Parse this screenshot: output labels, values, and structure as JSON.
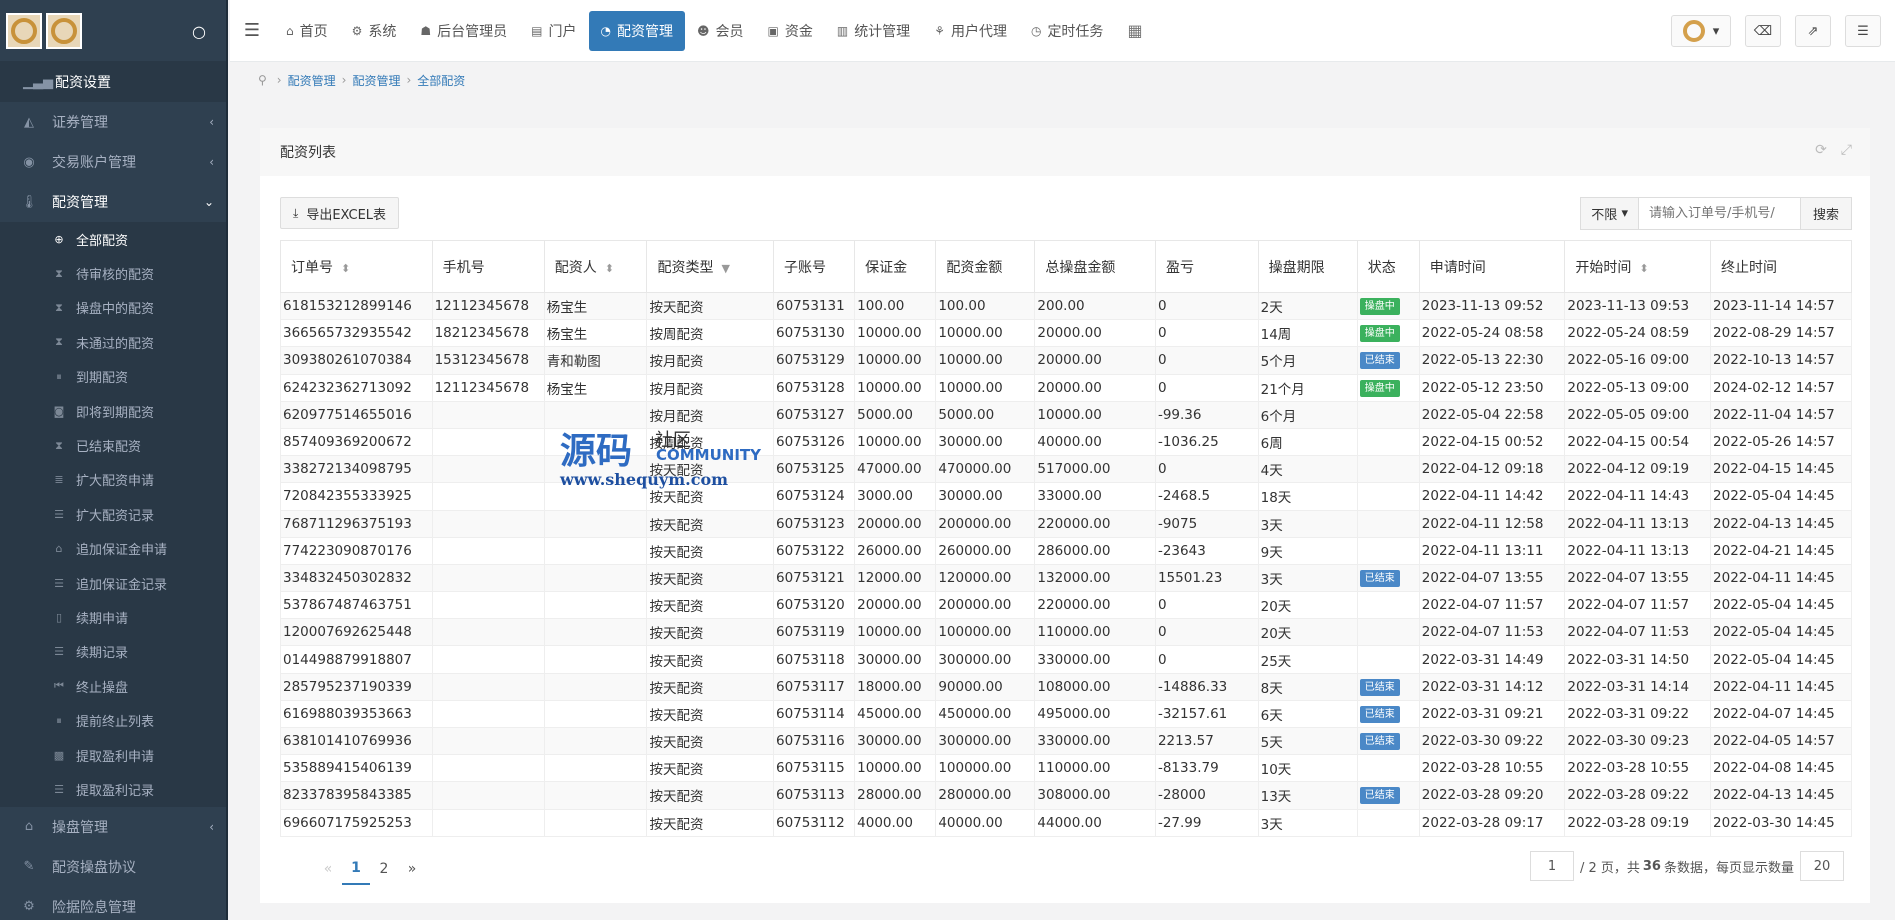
{
  "sidebar": {
    "items": [
      {
        "label": "配资设置",
        "icon": "bar-chart-icon"
      },
      {
        "label": "证券管理",
        "icon": "area-chart-icon",
        "arrow": "‹"
      },
      {
        "label": "交易账户管理",
        "icon": "user-circle-icon",
        "arrow": "‹"
      },
      {
        "label": "配资管理",
        "icon": "thermometer-icon",
        "arrow": "⌄"
      }
    ],
    "sub_items": [
      {
        "label": "全部配资",
        "icon": "globe-icon"
      },
      {
        "label": "待审核的配资",
        "icon": "hourglass-icon"
      },
      {
        "label": "操盘中的配资",
        "icon": "hourglass-icon"
      },
      {
        "label": "未通过的配资",
        "icon": "hourglass-icon"
      },
      {
        "label": "到期配资",
        "icon": "pause-icon"
      },
      {
        "label": "即将到期配资",
        "icon": "camera-icon"
      },
      {
        "label": "已结束配资",
        "icon": "hourglass-icon"
      },
      {
        "label": "扩大配资申请",
        "icon": "stack-icon"
      },
      {
        "label": "扩大配资记录",
        "icon": "list-icon"
      },
      {
        "label": "追加保证金申请",
        "icon": "bank-icon"
      },
      {
        "label": "追加保证金记录",
        "icon": "list-icon"
      },
      {
        "label": "续期申请",
        "icon": "file-icon"
      },
      {
        "label": "续期记录",
        "icon": "list-icon"
      },
      {
        "label": "终止操盘",
        "icon": "backward-icon"
      },
      {
        "label": "提前终止列表",
        "icon": "pause-icon"
      },
      {
        "label": "提取盈利申请",
        "icon": "save-icon"
      },
      {
        "label": "提取盈利记录",
        "icon": "list-icon"
      }
    ],
    "bottom_items": [
      {
        "label": "操盘管理",
        "icon": "bank-icon",
        "arrow": "‹"
      },
      {
        "label": "配资操盘协议",
        "icon": "pencil-icon"
      },
      {
        "label": "险据险息管理",
        "icon": "gear-icon"
      }
    ]
  },
  "topnav": {
    "tabs": [
      {
        "label": "首页",
        "icon": "home-icon",
        "glyph": "⌂"
      },
      {
        "label": "系统",
        "icon": "gear-icon",
        "glyph": "⚙"
      },
      {
        "label": "后台管理员",
        "icon": "user-icon",
        "glyph": "☗"
      },
      {
        "label": "门户",
        "icon": "newspaper-icon",
        "glyph": "▤"
      },
      {
        "label": "配资管理",
        "icon": "pie-chart-icon",
        "glyph": "◔"
      },
      {
        "label": "会员",
        "icon": "users-icon",
        "glyph": "☻"
      },
      {
        "label": "资金",
        "icon": "money-icon",
        "glyph": "▣"
      },
      {
        "label": "统计管理",
        "icon": "bar-chart-icon",
        "glyph": "▥"
      },
      {
        "label": "用户代理",
        "icon": "sitemap-icon",
        "glyph": "⚘"
      },
      {
        "label": "定时任务",
        "icon": "clock-icon",
        "glyph": "◷"
      }
    ]
  },
  "breadcrumb": [
    "配资管理",
    "配资管理",
    "全部配资"
  ],
  "panel": {
    "title": "配资列表",
    "export_label": "导出EXCEL表",
    "filter_select": "不限",
    "search_placeholder": "请输入订单号/手机号/",
    "search_button": "搜索"
  },
  "table": {
    "headers": [
      "订单号",
      "手机号",
      "配资人",
      "配资类型",
      "子账号",
      "保证金",
      "配资金额",
      "总操盘金额",
      "盈亏",
      "操盘期限",
      "状态",
      "申请时间",
      "开始时间",
      "终止时间"
    ],
    "rows": [
      [
        "618153212899146",
        "12112345678",
        "杨宝生",
        "按天配资",
        "60753131",
        "100.00",
        "100.00",
        "200.00",
        "0",
        "2天",
        "操盘中",
        "2023-11-13 09:52",
        "2023-11-13 09:53",
        "2023-11-14 14:57"
      ],
      [
        "366565732935542",
        "18212345678",
        "杨宝生",
        "按周配资",
        "60753130",
        "10000.00",
        "10000.00",
        "20000.00",
        "0",
        "14周",
        "操盘中",
        "2022-05-24 08:58",
        "2022-05-24 08:59",
        "2022-08-29 14:57"
      ],
      [
        "309380261070384",
        "15312345678",
        "青和勒图",
        "按月配资",
        "60753129",
        "10000.00",
        "10000.00",
        "20000.00",
        "0",
        "5个月",
        "已结束",
        "2022-05-13 22:30",
        "2022-05-16 09:00",
        "2022-10-13 14:57"
      ],
      [
        "624232362713092",
        "12112345678",
        "杨宝生",
        "按月配资",
        "60753128",
        "10000.00",
        "10000.00",
        "20000.00",
        "0",
        "21个月",
        "操盘中",
        "2022-05-12 23:50",
        "2022-05-13 09:00",
        "2024-02-12 14:57"
      ],
      [
        "620977514655016",
        "",
        "",
        "按月配资",
        "60753127",
        "5000.00",
        "5000.00",
        "10000.00",
        "-99.36",
        "6个月",
        "",
        "2022-05-04 22:58",
        "2022-05-05 09:00",
        "2022-11-04 14:57"
      ],
      [
        "857409369200672",
        "",
        "",
        "按周配资",
        "60753126",
        "10000.00",
        "30000.00",
        "40000.00",
        "-1036.25",
        "6周",
        "",
        "2022-04-15 00:52",
        "2022-04-15 00:54",
        "2022-05-26 14:57"
      ],
      [
        "338272134098795",
        "",
        "",
        "按天配资",
        "60753125",
        "47000.00",
        "470000.00",
        "517000.00",
        "0",
        "4天",
        "",
        "2022-04-12 09:18",
        "2022-04-12 09:19",
        "2022-04-15 14:45"
      ],
      [
        "720842355333925",
        "",
        "",
        "按天配资",
        "60753124",
        "3000.00",
        "30000.00",
        "33000.00",
        "-2468.5",
        "18天",
        "",
        "2022-04-11 14:42",
        "2022-04-11 14:43",
        "2022-05-04 14:45"
      ],
      [
        "768711296375193",
        "",
        "",
        "按天配资",
        "60753123",
        "20000.00",
        "200000.00",
        "220000.00",
        "-9075",
        "3天",
        "",
        "2022-04-11 12:58",
        "2022-04-11 13:13",
        "2022-04-13 14:45"
      ],
      [
        "774223090870176",
        "",
        "",
        "按天配资",
        "60753122",
        "26000.00",
        "260000.00",
        "286000.00",
        "-23643",
        "9天",
        "",
        "2022-04-11 13:11",
        "2022-04-11 13:13",
        "2022-04-21 14:45"
      ],
      [
        "334832450302832",
        "",
        "",
        "按天配资",
        "60753121",
        "12000.00",
        "120000.00",
        "132000.00",
        "15501.23",
        "3天",
        "已结束",
        "2022-04-07 13:55",
        "2022-04-07 13:55",
        "2022-04-11 14:45"
      ],
      [
        "537867487463751",
        "",
        "",
        "按天配资",
        "60753120",
        "20000.00",
        "200000.00",
        "220000.00",
        "0",
        "20天",
        "",
        "2022-04-07 11:57",
        "2022-04-07 11:57",
        "2022-05-04 14:45"
      ],
      [
        "120007692625448",
        "",
        "",
        "按天配资",
        "60753119",
        "10000.00",
        "100000.00",
        "110000.00",
        "0",
        "20天",
        "",
        "2022-04-07 11:53",
        "2022-04-07 11:53",
        "2022-05-04 14:45"
      ],
      [
        "014498879918807",
        "",
        "",
        "按天配资",
        "60753118",
        "30000.00",
        "300000.00",
        "330000.00",
        "0",
        "25天",
        "",
        "2022-03-31 14:49",
        "2022-03-31 14:50",
        "2022-05-04 14:45"
      ],
      [
        "285795237190339",
        "",
        "",
        "按天配资",
        "60753117",
        "18000.00",
        "90000.00",
        "108000.00",
        "-14886.33",
        "8天",
        "已结束",
        "2022-03-31 14:12",
        "2022-03-31 14:14",
        "2022-04-11 14:45"
      ],
      [
        "616988039353663",
        "",
        "",
        "按天配资",
        "60753114",
        "45000.00",
        "450000.00",
        "495000.00",
        "-32157.61",
        "6天",
        "已结束",
        "2022-03-31 09:21",
        "2022-03-31 09:22",
        "2022-04-07 14:45"
      ],
      [
        "638101410769936",
        "",
        "",
        "按天配资",
        "60753116",
        "30000.00",
        "300000.00",
        "330000.00",
        "2213.57",
        "5天",
        "已结束",
        "2022-03-30 09:22",
        "2022-03-30 09:23",
        "2022-04-05 14:57"
      ],
      [
        "535889415406139",
        "",
        "",
        "按天配资",
        "60753115",
        "10000.00",
        "100000.00",
        "110000.00",
        "-8133.79",
        "10天",
        "",
        "2022-03-28 10:55",
        "2022-03-28 10:55",
        "2022-04-08 14:45"
      ],
      [
        "823378395843385",
        "",
        "",
        "按天配资",
        "60753113",
        "28000.00",
        "280000.00",
        "308000.00",
        "-28000",
        "13天",
        "已结束",
        "2022-03-28 09:20",
        "2022-03-28 09:22",
        "2022-04-13 14:45"
      ],
      [
        "696607175925253",
        "",
        "",
        "按天配资",
        "60753112",
        "4000.00",
        "40000.00",
        "44000.00",
        "-27.99",
        "3天",
        "",
        "2022-03-28 09:17",
        "2022-03-28 09:19",
        "2022-03-30 14:45"
      ]
    ],
    "status_colors": {
      "操盘中": "#3bb15d",
      "已结束": "#4a88c7"
    }
  },
  "pagination": {
    "prev": "«",
    "pages": [
      "1",
      "2"
    ],
    "next": "»",
    "current_page_input": "1",
    "total_pages_text": "/ 2 页，共",
    "total_count": "36",
    "count_suffix": "条数据，每页显示数量",
    "per_page": "20"
  },
  "watermark": {
    "big": "源码",
    "small": "社区",
    "community": "COMMUNITY",
    "url": "www.shequym.com"
  }
}
